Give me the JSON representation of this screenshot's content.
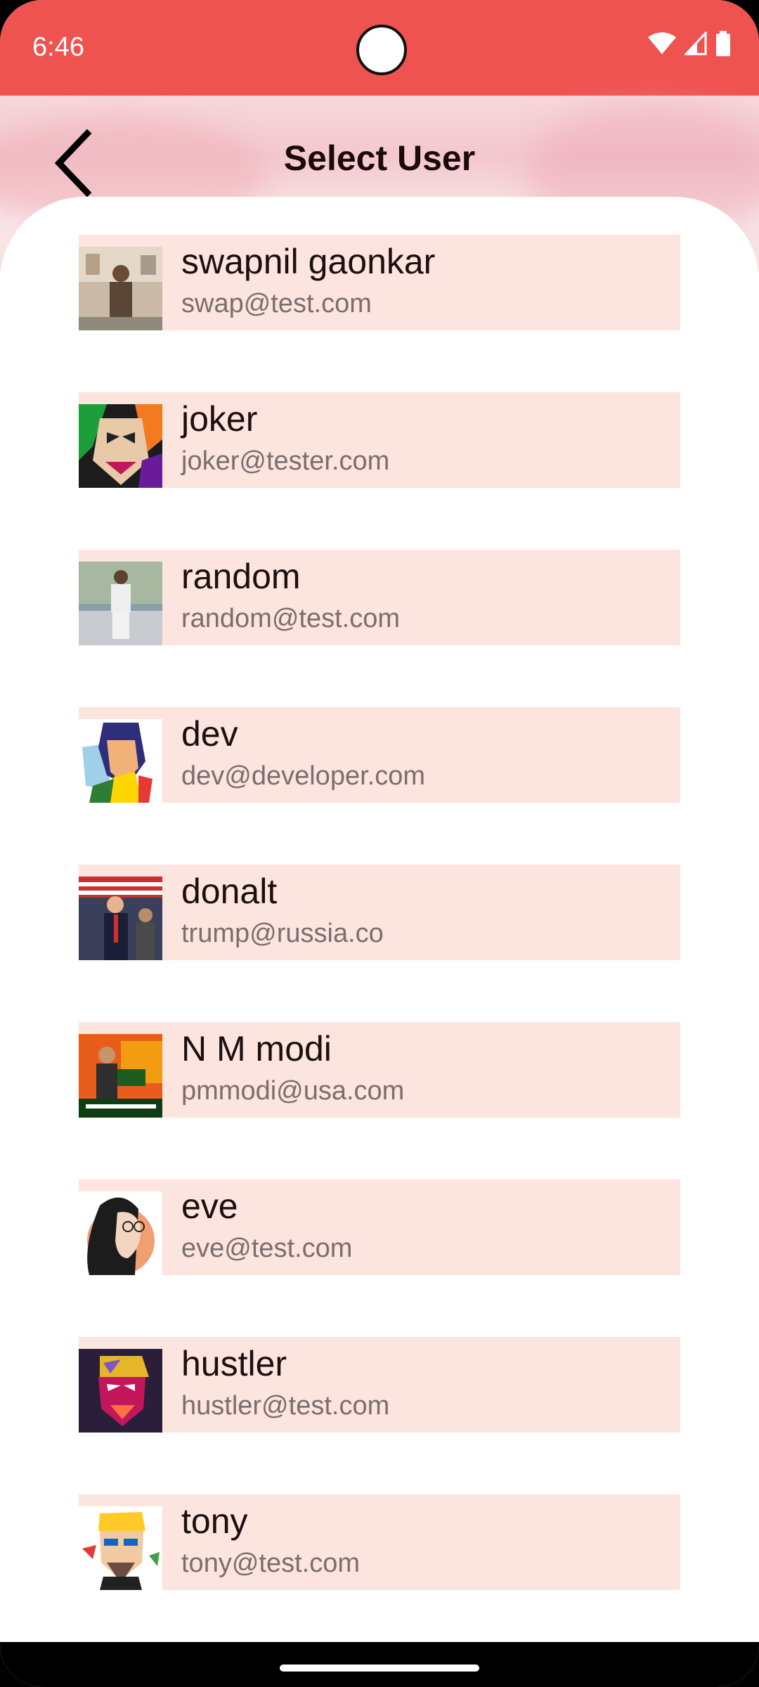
{
  "status_bar": {
    "time": "6:46",
    "icons": [
      "wifi-icon",
      "signal-icon",
      "battery-icon"
    ]
  },
  "header": {
    "title": "Select User",
    "back_icon": "chevron-left-icon"
  },
  "colors": {
    "status_bar": "#ef5350",
    "item_background": "#fce4df",
    "title_text": "#1a0a0a",
    "email_text": "#7a6e6e"
  },
  "users": [
    {
      "name": "swapnil gaonkar",
      "email": "swap@test.com"
    },
    {
      "name": "joker",
      "email": "joker@tester.com"
    },
    {
      "name": "random",
      "email": "random@test.com"
    },
    {
      "name": "dev",
      "email": "dev@developer.com"
    },
    {
      "name": "donalt",
      "email": "trump@russia.co"
    },
    {
      "name": "N M modi",
      "email": "pmmodi@usa.com"
    },
    {
      "name": "eve",
      "email": "eve@test.com"
    },
    {
      "name": "hustler",
      "email": "hustler@test.com"
    },
    {
      "name": "tony",
      "email": "tony@test.com"
    }
  ]
}
